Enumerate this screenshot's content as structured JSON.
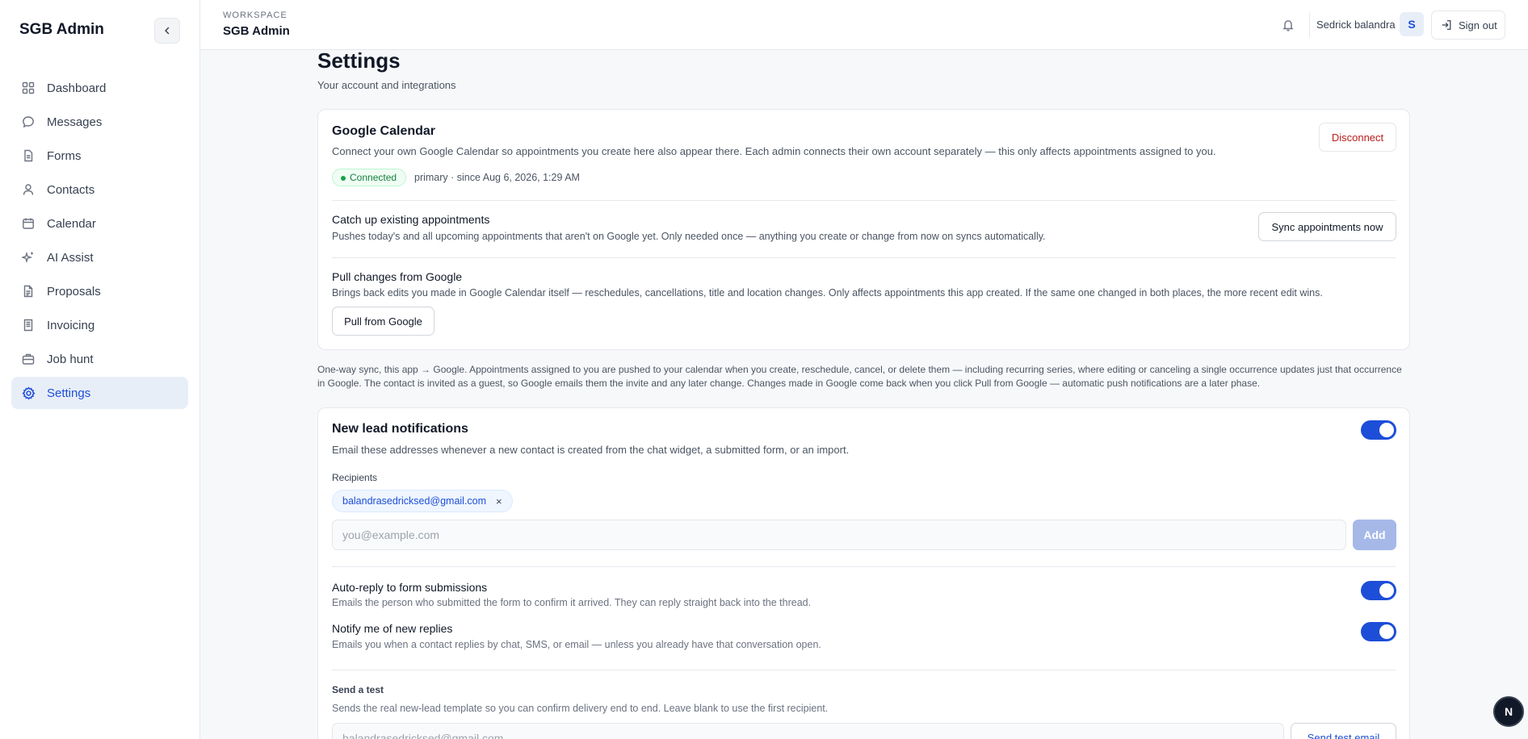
{
  "sidebar": {
    "brand": "SGB Admin",
    "items": [
      {
        "label": "Dashboard",
        "icon": "grid-icon"
      },
      {
        "label": "Messages",
        "icon": "chat-bubble-icon"
      },
      {
        "label": "Forms",
        "icon": "document-icon"
      },
      {
        "label": "Contacts",
        "icon": "user-icon"
      },
      {
        "label": "Calendar",
        "icon": "calendar-icon"
      },
      {
        "label": "AI Assist",
        "icon": "sparkle-icon"
      },
      {
        "label": "Proposals",
        "icon": "file-text-icon"
      },
      {
        "label": "Invoicing",
        "icon": "receipt-icon"
      },
      {
        "label": "Job hunt",
        "icon": "briefcase-icon"
      },
      {
        "label": "Settings",
        "icon": "gear-icon",
        "active": true
      }
    ]
  },
  "topbar": {
    "workspace_label": "WORKSPACE",
    "workspace_name": "SGB Admin",
    "user_name": "Sedrick balandra",
    "avatar_initial": "S",
    "signout_label": "Sign out"
  },
  "page": {
    "title": "Settings",
    "subtitle": "Your account and integrations"
  },
  "google_calendar": {
    "title": "Google Calendar",
    "description": "Connect your own Google Calendar so appointments you create here also appear there. Each admin connects their own account separately — this only affects appointments assigned to you.",
    "disconnect_label": "Disconnect",
    "status": "Connected",
    "status_detail": "primary · since Aug 6, 2026, 1:29 AM",
    "catchup_title": "Catch up existing appointments",
    "catchup_desc": "Pushes today's and all upcoming appointments that aren't on Google yet. Only needed once — anything you create or change from now on syncs automatically.",
    "sync_label": "Sync appointments now",
    "pull_title": "Pull changes from Google",
    "pull_desc": "Brings back edits you made in Google Calendar itself — reschedules, cancellations, title and location changes. Only affects appointments this app created. If the same one changed in both places, the more recent edit wins.",
    "pull_label": "Pull from Google"
  },
  "sync_note": "One-way sync, this app → Google. Appointments assigned to you are pushed to your calendar when you create, reschedule, cancel, or delete them — including recurring series, where editing or canceling a single occurrence updates just that occurrence in Google. The contact is invited as a guest, so Google emails them the invite and any later change. Changes made in Google come back when you click Pull from Google — automatic push notifications are a later phase.",
  "lead_notifications": {
    "title": "New lead notifications",
    "enabled": true,
    "description": "Email these addresses whenever a new contact is created from the chat widget, a submitted form, or an import.",
    "recipients_label": "Recipients",
    "recipients": [
      "balandrasedricksed@gmail.com"
    ],
    "remove_glyph": "×",
    "input_placeholder": "you@example.com",
    "add_label": "Add",
    "autoreply_title": "Auto-reply to form submissions",
    "autoreply_desc": "Emails the person who submitted the form to confirm it arrived. They can reply straight back into the thread.",
    "autoreply_enabled": true,
    "replies_title": "Notify me of new replies",
    "replies_desc": "Emails you when a contact replies by chat, SMS, or email — unless you already have that conversation open.",
    "replies_enabled": true,
    "test_title": "Send a test",
    "test_desc": "Sends the real new-lead template so you can confirm delivery end to end. Leave blank to use the first recipient.",
    "test_placeholder": "balandrasedricksed@gmail.com",
    "test_button": "Send test email"
  },
  "fab_label": "N",
  "colors": {
    "accent": "#1d4ed8",
    "active_bg": "#e8eef8",
    "connected": "#15803d",
    "danger": "#b91c1c"
  }
}
